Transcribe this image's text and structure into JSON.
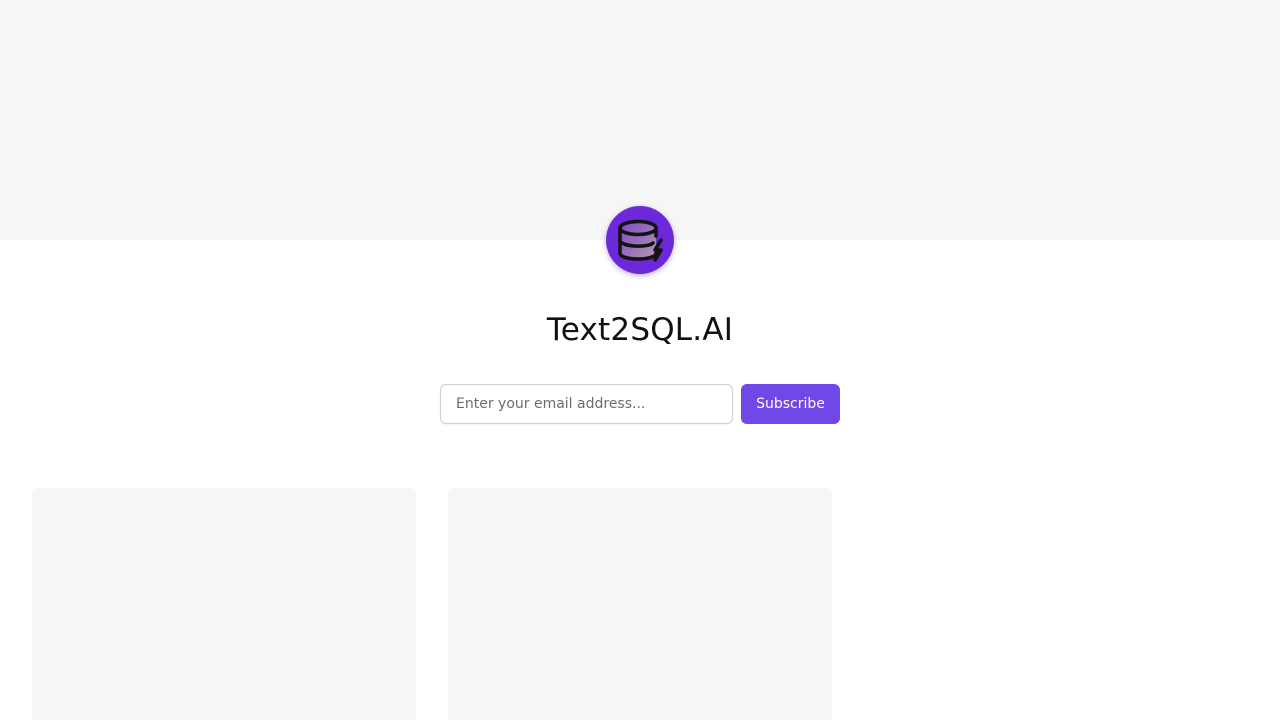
{
  "site": {
    "title": "Text2SQL.AI",
    "logo_icon": "database-bolt-icon",
    "accent_color": "#6d28d9"
  },
  "subscribe": {
    "email_placeholder": "Enter your email address...",
    "email_value": "",
    "button_label": "Subscribe",
    "button_color": "#7048e8"
  },
  "posts": [
    {
      "id": "post-1"
    },
    {
      "id": "post-2"
    }
  ]
}
